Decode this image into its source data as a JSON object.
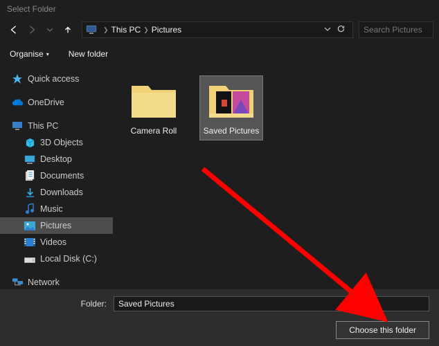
{
  "title": "Select Folder",
  "breadcrumb": {
    "seg1": "This PC",
    "seg2": "Pictures"
  },
  "search": {
    "placeholder": "Search Pictures"
  },
  "toolbar": {
    "organise": "Organise",
    "newfolder": "New folder"
  },
  "sidebar": {
    "quick": "Quick access",
    "onedrive": "OneDrive",
    "thispc": "This PC",
    "objects3d": "3D Objects",
    "desktop": "Desktop",
    "documents": "Documents",
    "downloads": "Downloads",
    "music": "Music",
    "pictures": "Pictures",
    "videos": "Videos",
    "localdisk": "Local Disk (C:)",
    "network": "Network"
  },
  "content": {
    "item1": "Camera Roll",
    "item2": "Saved Pictures"
  },
  "footer": {
    "label": "Folder:",
    "value": "Saved Pictures",
    "choose": "Choose this folder"
  }
}
